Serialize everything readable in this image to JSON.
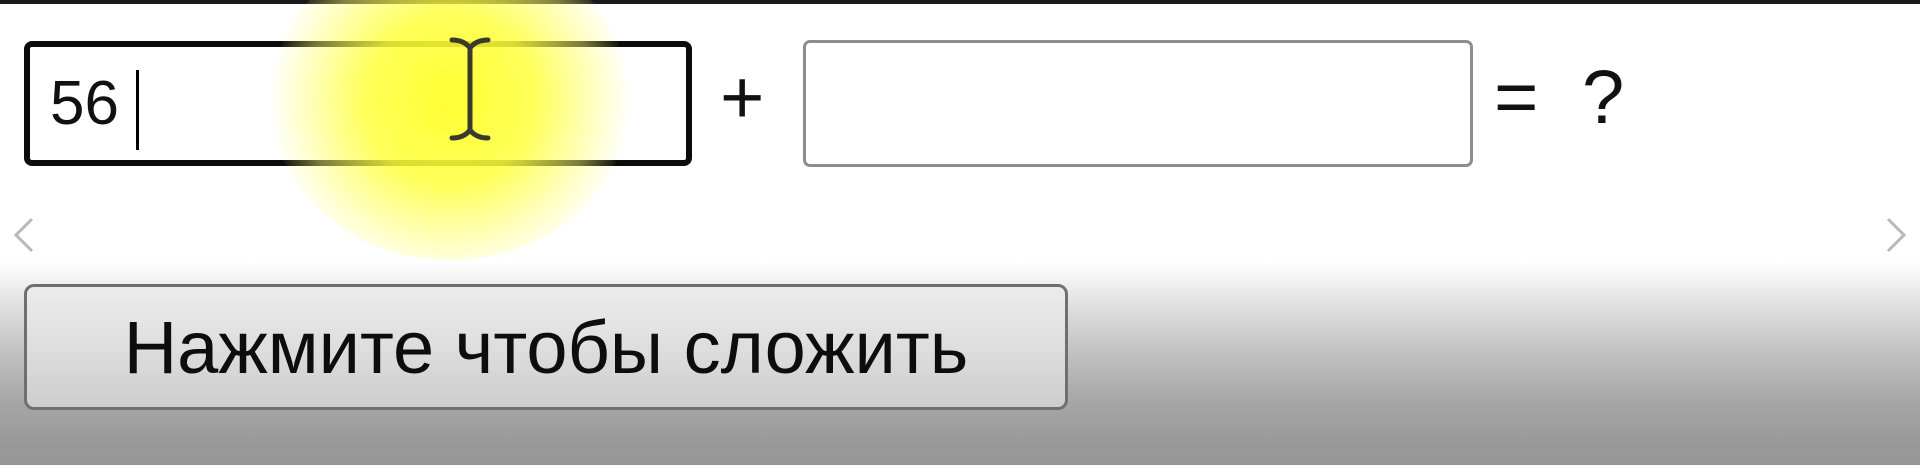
{
  "form": {
    "first_number": {
      "value": "56",
      "placeholder": ""
    },
    "plus_sign": "+",
    "second_number": {
      "value": "",
      "placeholder": ""
    },
    "equals_sign": "=",
    "result": "?",
    "submit_label": "Нажмите чтобы сложить"
  },
  "icons": {
    "scroll_left": "chevron-left-icon",
    "scroll_right": "chevron-right-icon",
    "cursor": "text-cursor-icon"
  },
  "colors": {
    "cursor_highlight": "#ffff3c",
    "focused_border": "#0c0c0c",
    "field_border": "#8d8d8d",
    "button_border": "#6f6f6f"
  }
}
